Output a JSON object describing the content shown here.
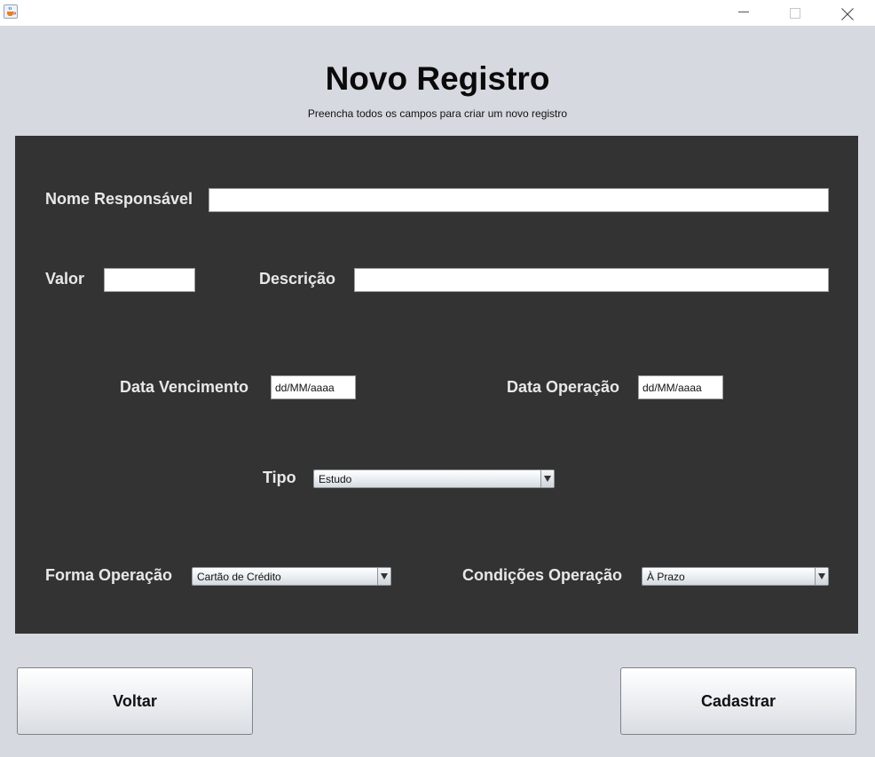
{
  "page": {
    "title": "Novo Registro",
    "subtitle": "Preencha todos os campos para criar um novo registro"
  },
  "form": {
    "nome_responsavel": {
      "label": "Nome Responsável",
      "value": ""
    },
    "valor": {
      "label": "Valor",
      "value": ""
    },
    "descricao": {
      "label": "Descrição",
      "value": ""
    },
    "data_vencimento": {
      "label": "Data Vencimento",
      "value": "dd/MM/aaaa"
    },
    "data_operacao": {
      "label": "Data Operação",
      "value": "dd/MM/aaaa"
    },
    "tipo": {
      "label": "Tipo",
      "selected": "Estudo"
    },
    "forma_operacao": {
      "label": "Forma Operação",
      "selected": "Cartão de Crédito"
    },
    "condicoes_operacao": {
      "label": "Condições Operação",
      "selected": "À Prazo"
    }
  },
  "buttons": {
    "voltar": "Voltar",
    "cadastrar": "Cadastrar"
  },
  "icons": {
    "app": "java-cup-icon",
    "minimize": "minimize-icon",
    "maximize": "maximize-icon",
    "close": "close-icon",
    "dropdown": "triangle-down-icon"
  },
  "colors": {
    "background": "#d6d9df",
    "panel": "#333333",
    "label_text": "#e8e8e8",
    "field_background": "#ffffff"
  }
}
